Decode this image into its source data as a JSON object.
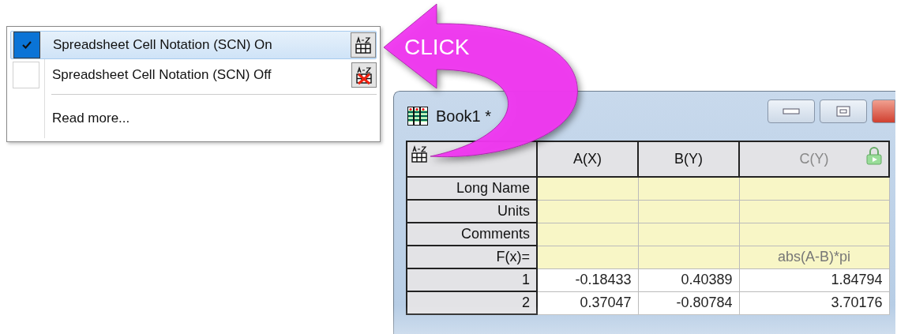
{
  "menu": {
    "items": [
      {
        "kind": "option",
        "label": "Spreadsheet Cell Notation (SCN) On",
        "checked": true,
        "selected": true
      },
      {
        "kind": "option",
        "label": "Spreadsheet Cell Notation (SCN) Off",
        "checked": false,
        "selected": false
      },
      {
        "kind": "separator"
      },
      {
        "kind": "link",
        "label": "Read more..."
      }
    ]
  },
  "callout": {
    "label": "CLICK"
  },
  "window": {
    "title": "Book1 *",
    "columns": [
      {
        "name": "A(X)"
      },
      {
        "name": "B(Y)"
      },
      {
        "name": "C(Y)",
        "formula": "abs(A-B)*pi"
      }
    ],
    "label_rows": [
      {
        "label": "Long Name"
      },
      {
        "label": "Units"
      },
      {
        "label": "Comments"
      }
    ],
    "formula_row": {
      "label": "F(x)="
    },
    "rows": [
      {
        "index": "1",
        "cells": [
          "-0.18433",
          "0.40389",
          "1.84794"
        ]
      },
      {
        "index": "2",
        "cells": [
          "0.37047",
          "-0.80784",
          "3.70176"
        ]
      }
    ]
  }
}
